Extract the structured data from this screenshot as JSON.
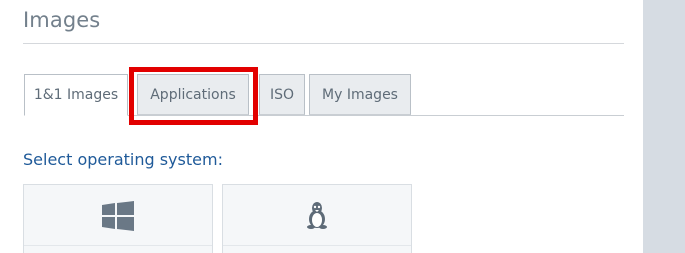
{
  "page": {
    "title": "Images"
  },
  "tabs": [
    {
      "label": "1&1 Images",
      "active": true
    },
    {
      "label": "Applications",
      "active": false,
      "highlighted": true
    },
    {
      "label": "ISO",
      "active": false
    },
    {
      "label": "My Images",
      "active": false
    }
  ],
  "os_section": {
    "label": "Select operating system:",
    "options": [
      {
        "icon": "windows-icon"
      },
      {
        "icon": "linux-icon"
      }
    ]
  },
  "colors": {
    "heading": "#73808c",
    "section_label": "#1f5a99",
    "highlight": "#e20000",
    "tab_inactive_bg": "#e9ecef",
    "sidebar_bg": "#d6dce3"
  }
}
